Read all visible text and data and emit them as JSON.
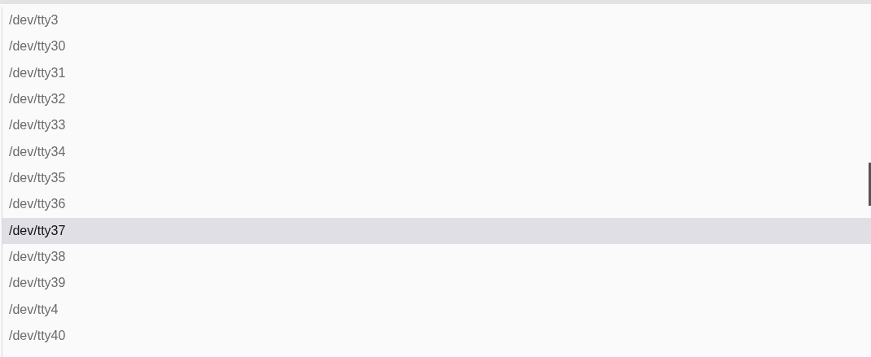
{
  "list": {
    "items": [
      {
        "label": "/dev/tty3",
        "selected": false
      },
      {
        "label": "/dev/tty30",
        "selected": false
      },
      {
        "label": "/dev/tty31",
        "selected": false
      },
      {
        "label": "/dev/tty32",
        "selected": false
      },
      {
        "label": "/dev/tty33",
        "selected": false
      },
      {
        "label": "/dev/tty34",
        "selected": false
      },
      {
        "label": "/dev/tty35",
        "selected": false
      },
      {
        "label": "/dev/tty36",
        "selected": false
      },
      {
        "label": "/dev/tty37",
        "selected": true
      },
      {
        "label": "/dev/tty38",
        "selected": false
      },
      {
        "label": "/dev/tty39",
        "selected": false
      },
      {
        "label": "/dev/tty4",
        "selected": false
      },
      {
        "label": "/dev/tty40",
        "selected": false
      }
    ]
  }
}
